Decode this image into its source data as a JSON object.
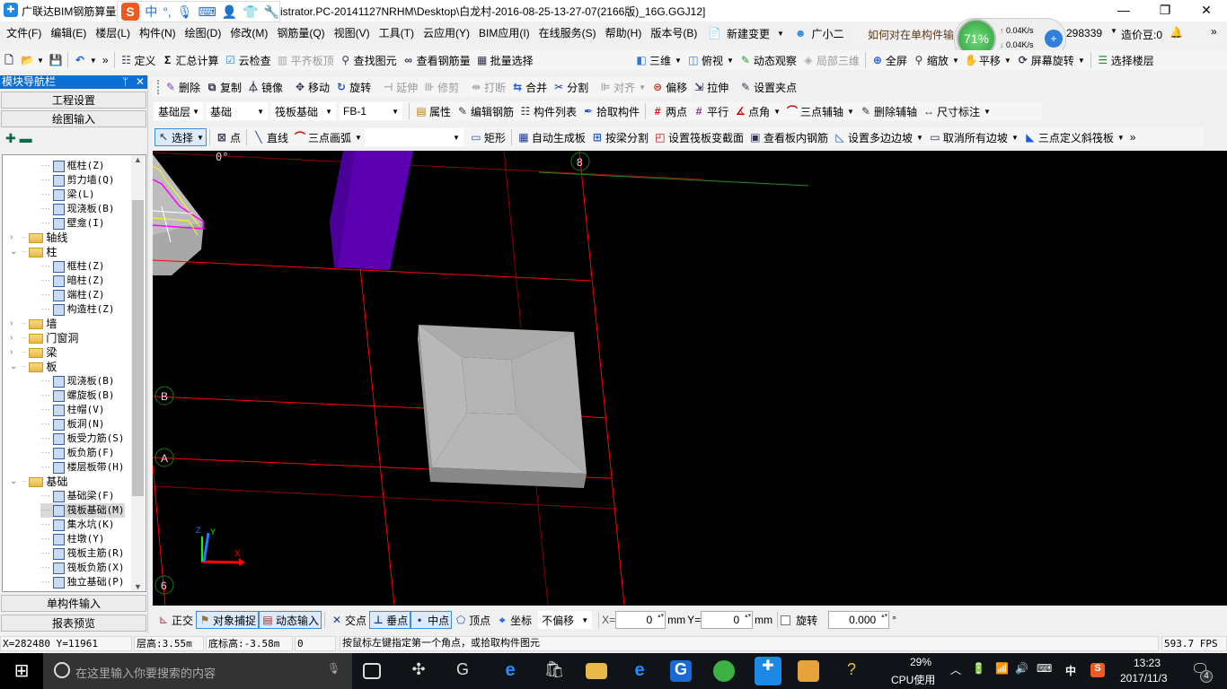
{
  "title": {
    "prefix": "广联达BIM钢筋算量",
    "suffix": "istrator.PC-20141127NRHM\\Desktop\\白龙村-2016-08-25-13-27-07(2166版)_16G.GGJ12]"
  },
  "ime": {
    "logo": "S",
    "mode": "中",
    "punct": "°,"
  },
  "menu": [
    "文件(F)",
    "编辑(E)",
    "楼层(L)",
    "构件(N)",
    "绘图(D)",
    "修改(M)",
    "钢筋量(Q)",
    "视图(V)",
    "工具(T)",
    "云应用(Y)",
    "BIM应用(I)",
    "在线服务(S)",
    "帮助(H)",
    "版本号(B)"
  ],
  "menu_extra": {
    "new_change": "新建变更",
    "assistant": "广小二",
    "news": "如何对在单构件输",
    "account": "298339",
    "beans": "造价豆:0"
  },
  "netmon": {
    "percent": "71%",
    "up": "0.04K/s",
    "down": "0.04K/s"
  },
  "toolbar1": [
    {
      "icon": "new-file"
    },
    {
      "icon": "open-folder",
      "dropdown": true
    },
    {
      "icon": "save"
    },
    {
      "sep": true
    },
    {
      "icon": "undo",
      "dropdown": true
    },
    {
      "icon": "more",
      "label": "»"
    },
    {
      "sep": true
    },
    {
      "icon": "define",
      "label": "定义"
    },
    {
      "icon": "sum",
      "label": "汇总计算"
    },
    {
      "icon": "cloud-check",
      "label": "云检查"
    },
    {
      "icon": "align-top",
      "label": "平齐板顶",
      "disabled": true
    },
    {
      "icon": "find",
      "label": "查找图元"
    },
    {
      "icon": "view-rebar",
      "label": "查看钢筋量"
    },
    {
      "icon": "batch-select",
      "label": "批量选择"
    }
  ],
  "toolbar1b": [
    {
      "icon": "3d",
      "label": "三维",
      "dropdown": true
    },
    {
      "icon": "top-view",
      "label": "俯视",
      "dropdown": true
    },
    {
      "icon": "orbit",
      "label": "动态观察"
    },
    {
      "icon": "local-3d",
      "label": "局部三维",
      "disabled": true
    },
    {
      "sep": true
    },
    {
      "icon": "fullscreen",
      "label": "全屏"
    },
    {
      "icon": "zoom",
      "label": "缩放",
      "dropdown": true
    },
    {
      "icon": "pan",
      "label": "平移",
      "dropdown": true
    },
    {
      "icon": "rotate-screen",
      "label": "屏幕旋转",
      "dropdown": true
    },
    {
      "sep": true
    },
    {
      "icon": "select-floor",
      "label": "选择楼层"
    }
  ],
  "toolbar2": [
    {
      "icon": "delete",
      "label": "删除"
    },
    {
      "icon": "copy",
      "label": "复制"
    },
    {
      "icon": "mirror",
      "label": "镜像"
    },
    {
      "sep": true
    },
    {
      "icon": "move",
      "label": "移动"
    },
    {
      "icon": "rotate",
      "label": "旋转"
    },
    {
      "sep": true
    },
    {
      "icon": "extend",
      "label": "延伸",
      "disabled": true
    },
    {
      "icon": "trim",
      "label": "修剪",
      "disabled": true
    },
    {
      "sep": true
    },
    {
      "icon": "break",
      "label": "打断",
      "disabled": true
    },
    {
      "icon": "merge",
      "label": "合并"
    },
    {
      "icon": "split",
      "label": "分割"
    },
    {
      "sep": true
    },
    {
      "icon": "align",
      "label": "对齐",
      "disabled": true,
      "dropdown": true
    },
    {
      "icon": "offset",
      "label": "偏移"
    },
    {
      "icon": "stretch",
      "label": "拉伸"
    },
    {
      "sep": true
    },
    {
      "icon": "grip-point",
      "label": "设置夹点"
    }
  ],
  "toolbar3": {
    "selects": [
      {
        "value": "基础层",
        "w": 54
      },
      {
        "value": "基础",
        "w": 68
      },
      {
        "value": "筏板基础",
        "w": 72
      },
      {
        "value": "FB-1",
        "w": 70
      }
    ],
    "items": [
      {
        "sep": true
      },
      {
        "icon": "properties",
        "label": "属性"
      },
      {
        "icon": "edit-rebar",
        "label": "编辑钢筋"
      },
      {
        "icon": "component-list",
        "label": "构件列表"
      },
      {
        "icon": "pick-component",
        "label": "拾取构件"
      },
      {
        "sep": true
      },
      {
        "icon": "two-point",
        "label": "两点"
      },
      {
        "icon": "parallel",
        "label": "平行"
      },
      {
        "icon": "point-angle",
        "label": "点角",
        "dropdown": true
      },
      {
        "icon": "three-point-axis",
        "label": "三点辅轴",
        "dropdown": true
      },
      {
        "icon": "delete-axis",
        "label": "删除辅轴"
      },
      {
        "icon": "dimension",
        "label": "尺寸标注",
        "dropdown": true
      }
    ]
  },
  "toolbar4": [
    {
      "icon": "select",
      "label": "选择",
      "pressed": true,
      "dropdown": true
    },
    {
      "sep": true
    },
    {
      "icon": "point",
      "label": "点"
    },
    {
      "sep": true
    },
    {
      "icon": "line",
      "label": "直线"
    },
    {
      "icon": "arc",
      "label": "三点画弧",
      "dropdown": true
    },
    {
      "select": ""
    },
    {
      "icon": "rectangle",
      "label": "矩形"
    },
    {
      "sep": true
    },
    {
      "icon": "auto-slab",
      "label": "自动生成板"
    },
    {
      "icon": "split-by-beam",
      "label": "按梁分割"
    },
    {
      "icon": "variable-section",
      "label": "设置筏板变截面"
    },
    {
      "icon": "view-slab-rebar",
      "label": "查看板内钢筋"
    },
    {
      "icon": "set-slope",
      "label": "设置多边边坡",
      "dropdown": true
    },
    {
      "icon": "cancel-slope",
      "label": "取消所有边坡",
      "dropdown": true
    },
    {
      "icon": "inclined-raft",
      "label": "三点定义斜筏板",
      "dropdown": true
    },
    {
      "icon": "more",
      "label": "»"
    }
  ],
  "nav": {
    "title": "模块导航栏",
    "pin": "ᛘ",
    "close": "✕",
    "top_buttons": [
      "工程设置",
      "绘图输入"
    ],
    "bottom_buttons": [
      "单构件输入",
      "报表预览"
    ],
    "tree": [
      {
        "label": "框柱(Z)",
        "level": 2
      },
      {
        "label": "剪力墙(Q)",
        "level": 2
      },
      {
        "label": "梁(L)",
        "level": 2
      },
      {
        "label": "现浇板(B)",
        "level": 2
      },
      {
        "label": "壁龛(I)",
        "level": 2
      },
      {
        "label": "轴线",
        "level": 1,
        "folder": true,
        "expanded": false
      },
      {
        "label": "柱",
        "level": 1,
        "folder": true,
        "expanded": true
      },
      {
        "label": "框柱(Z)",
        "level": 2
      },
      {
        "label": "暗柱(Z)",
        "level": 2
      },
      {
        "label": "端柱(Z)",
        "level": 2
      },
      {
        "label": "构造柱(Z)",
        "level": 2
      },
      {
        "label": "墙",
        "level": 1,
        "folder": true,
        "expanded": false
      },
      {
        "label": "门窗洞",
        "level": 1,
        "folder": true,
        "expanded": false
      },
      {
        "label": "梁",
        "level": 1,
        "folder": true,
        "expanded": false
      },
      {
        "label": "板",
        "level": 1,
        "folder": true,
        "expanded": true
      },
      {
        "label": "现浇板(B)",
        "level": 2
      },
      {
        "label": "螺旋板(B)",
        "level": 2
      },
      {
        "label": "柱帽(V)",
        "level": 2
      },
      {
        "label": "板洞(N)",
        "level": 2
      },
      {
        "label": "板受力筋(S)",
        "level": 2
      },
      {
        "label": "板负筋(F)",
        "level": 2
      },
      {
        "label": "楼层板带(H)",
        "level": 2
      },
      {
        "label": "基础",
        "level": 1,
        "folder": true,
        "expanded": true
      },
      {
        "label": "基础梁(F)",
        "level": 2
      },
      {
        "label": "筏板基础(M)",
        "level": 2,
        "selected": true
      },
      {
        "label": "集水坑(K)",
        "level": 2
      },
      {
        "label": "柱墩(Y)",
        "level": 2
      },
      {
        "label": "筏板主筋(R)",
        "level": 2
      },
      {
        "label": "筏板负筋(X)",
        "level": 2
      },
      {
        "label": "独立基础(P)",
        "level": 2
      }
    ]
  },
  "viewport": {
    "angle": "0°",
    "axis_labels": [
      "8",
      "B",
      "A",
      "6"
    ],
    "axes": {
      "x": "X",
      "y": "Y",
      "z": "Z"
    },
    "colors": {
      "column": "#5a00b0",
      "raft": "#b4b4b4",
      "grid": "#ff0000"
    }
  },
  "bottombar": {
    "items": [
      {
        "icon": "ortho",
        "label": "正交"
      },
      {
        "icon": "object-snap",
        "label": "对象捕捉",
        "pressed": true
      },
      {
        "icon": "dynamic-input",
        "label": "动态输入",
        "pressed": true
      },
      {
        "sep": true
      },
      {
        "icon": "intersection",
        "label": "交点"
      },
      {
        "icon": "perpendicular",
        "label": "垂点",
        "pressed": true
      },
      {
        "icon": "midpoint",
        "label": "中点",
        "pressed": true
      },
      {
        "icon": "vertex",
        "label": "顶点"
      },
      {
        "icon": "coordinate",
        "label": "坐标"
      }
    ],
    "offset": "不偏移",
    "x_label": "X=",
    "x_value": "0",
    "mm": "mm",
    "y_label": "Y=",
    "y_value": "0",
    "rotate_label": "旋转",
    "rotate_value": "0.000",
    "degree": "°"
  },
  "status": {
    "coords": "X=282480 Y=11961",
    "floor_height": "层高:3.55m",
    "bottom_elev": "底标高:-3.58m",
    "zero": "0",
    "hint": "按鼠标左键指定第一个角点，或拾取构件图元",
    "fps": "593.7 FPS"
  },
  "taskbar": {
    "search_placeholder": "在这里输入你要搜索的内容",
    "cpu": "29%",
    "cpu_label": "CPU使用",
    "ime": "中",
    "time": "13:23",
    "date": "2017/11/3",
    "notifications": "4"
  }
}
